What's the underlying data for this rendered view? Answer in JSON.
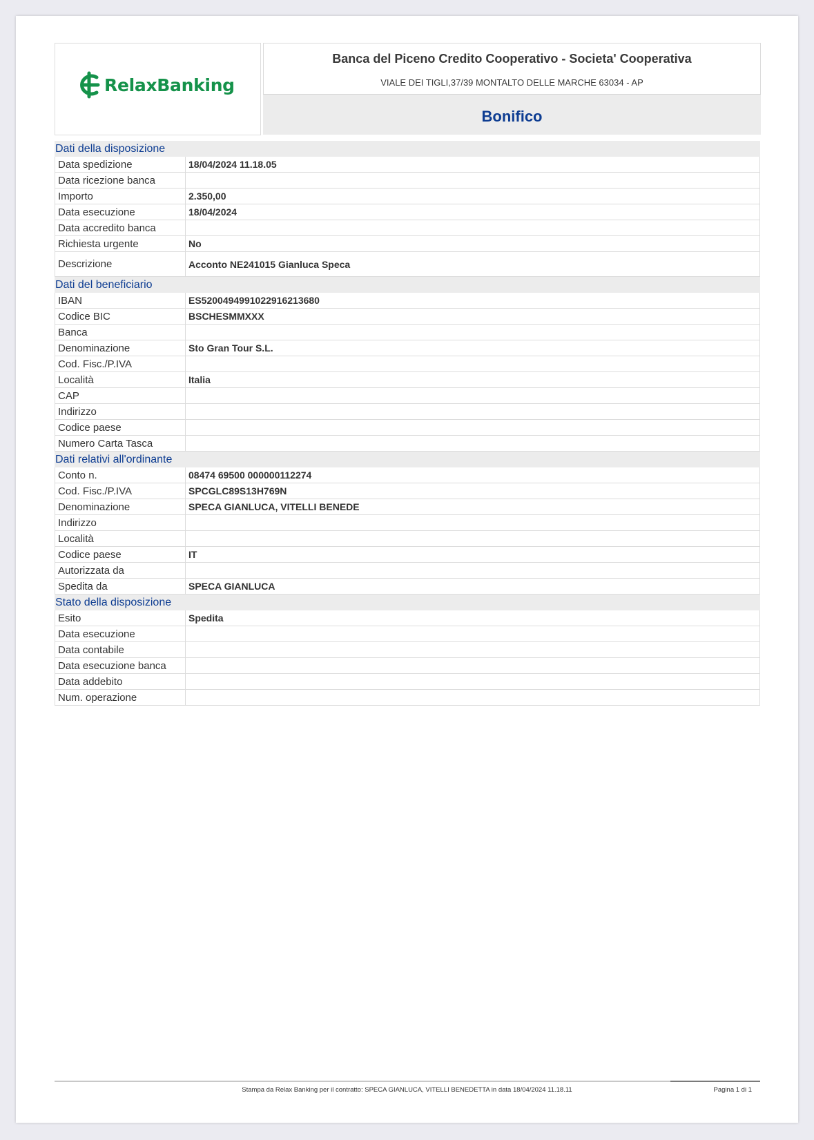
{
  "header": {
    "logo_text": "RelaxBanking",
    "bank_name": "Banca del Piceno Credito Cooperativo - Societa' Cooperativa",
    "bank_address": "VIALE DEI TIGLI,37/39 MONTALTO DELLE MARCHE 63034 - AP",
    "doc_title": "Bonifico",
    "brand_color": "#15924a",
    "title_color": "#0e3d92"
  },
  "disposizione": {
    "title": "Dati della disposizione",
    "rows": [
      {
        "label": "Data spedizione",
        "value": "18/04/2024 11.18.05"
      },
      {
        "label": "Data ricezione banca",
        "value": ""
      },
      {
        "label": "Importo",
        "value": "2.350,00"
      },
      {
        "label": "Data esecuzione",
        "value": "18/04/2024"
      },
      {
        "label": "Data accredito banca",
        "value": ""
      },
      {
        "label": "Richiesta urgente",
        "value": "No"
      },
      {
        "label": "Descrizione",
        "value": "Acconto  NE241015 Gianluca Speca"
      }
    ]
  },
  "beneficiario": {
    "title": "Dati del beneficiario",
    "rows": [
      {
        "label": "IBAN",
        "value": "ES5200494991022916213680"
      },
      {
        "label": "Codice BIC",
        "value": "BSCHESMMXXX"
      },
      {
        "label": "Banca",
        "value": ""
      },
      {
        "label": "Denominazione",
        "value": "Sto Gran Tour S.L."
      },
      {
        "label": "Cod. Fisc./P.IVA",
        "value": ""
      },
      {
        "label": "Località",
        "value": "Italia"
      },
      {
        "label": "CAP",
        "value": ""
      },
      {
        "label": "Indirizzo",
        "value": ""
      },
      {
        "label": "Codice paese",
        "value": ""
      },
      {
        "label": "Numero Carta Tasca",
        "value": ""
      }
    ]
  },
  "ordinante": {
    "title": "Dati relativi all'ordinante",
    "rows": [
      {
        "label": "Conto n.",
        "value": "08474 69500 000000112274"
      },
      {
        "label": "Cod. Fisc./P.IVA",
        "value": "SPCGLC89S13H769N"
      },
      {
        "label": "Denominazione",
        "value": "SPECA GIANLUCA, VITELLI BENEDE"
      },
      {
        "label": "Indirizzo",
        "value": ""
      },
      {
        "label": "Località",
        "value": ""
      },
      {
        "label": "Codice paese",
        "value": "IT"
      },
      {
        "label": "Autorizzata da",
        "value": ""
      },
      {
        "label": "Spedita da",
        "value": "SPECA GIANLUCA"
      }
    ]
  },
  "stato": {
    "title": "Stato della disposizione",
    "rows": [
      {
        "label": "Esito",
        "value": "Spedita"
      },
      {
        "label": "Data esecuzione",
        "value": ""
      },
      {
        "label": "Data contabile",
        "value": ""
      },
      {
        "label": "Data esecuzione banca",
        "value": ""
      },
      {
        "label": "Data addebito",
        "value": ""
      },
      {
        "label": "Num. operazione",
        "value": ""
      }
    ]
  },
  "footer": {
    "print_text": "Stampa da Relax Banking per il contratto: SPECA GIANLUCA, VITELLI BENEDETTA in data 18/04/2024 11.18.11",
    "page_text": "Pagina 1 di    1"
  }
}
